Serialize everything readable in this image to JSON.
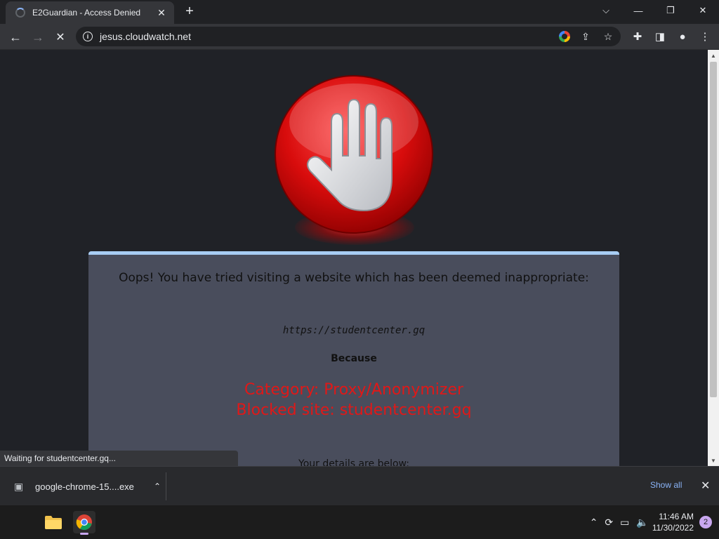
{
  "browser": {
    "tab": {
      "title": "E2Guardian - Access Denied",
      "close_icon": "✕"
    },
    "new_tab_icon": "+",
    "window_controls": {
      "dropdown": "⌵",
      "minimize": "—",
      "restore": "❐",
      "close": "✕"
    },
    "toolbar": {
      "back": "←",
      "forward": "→",
      "stop": "✕",
      "url": "jesus.cloudwatch.net",
      "info_icon": "i",
      "share_icon": "⇪",
      "bookmark_icon": "☆",
      "extensions_icon": "✚",
      "sidepanel_icon": "◨",
      "profile_icon": "●",
      "menu_icon": "⋮"
    },
    "status_text": "Waiting for studentcenter.gq..."
  },
  "page": {
    "heading": "Oops! You have tried visiting a website which has been deemed inappropriate:",
    "blocked_url": "https://studentcenter.gq",
    "because_label": "Because",
    "reason_line1": "Category: Proxy/Anonymizer",
    "reason_line2": "Blocked site: studentcenter.gq",
    "details_label": "Your details are below:",
    "colors": {
      "reason": "#e01818",
      "panel": "#494d5c",
      "panel_top": "#a8cdf4"
    }
  },
  "downloads": {
    "file_name": "google-chrome-15....exe",
    "show_all": "Show all",
    "chevron": "⌃",
    "close": "✕"
  },
  "taskbar": {
    "tray_chevron": "⌃",
    "time": "11:46 AM",
    "date": "11/30/2022",
    "notifications": "2"
  }
}
